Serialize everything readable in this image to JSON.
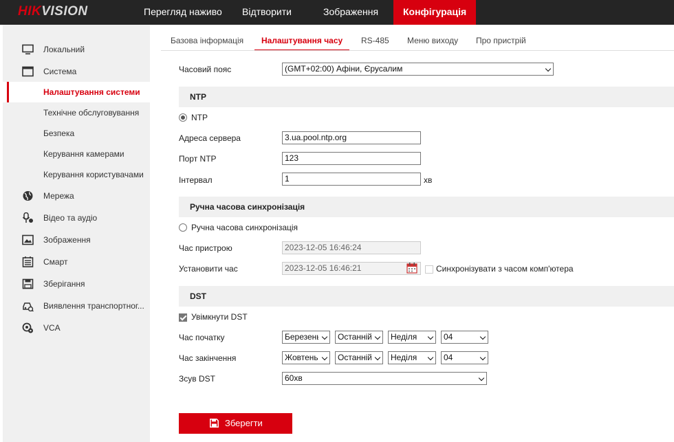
{
  "brand": {
    "part1": "HIK",
    "part2": "VISION"
  },
  "nav": [
    {
      "label": "Перегляд наживо"
    },
    {
      "label": "Відтворити"
    },
    {
      "label": "Зображення"
    },
    {
      "label": "Конфігурація"
    }
  ],
  "sidebar": {
    "items": [
      {
        "label": "Локальний",
        "icon": "monitor-icon"
      },
      {
        "label": "Система",
        "icon": "system-icon"
      },
      {
        "label": "Налаштування системи"
      },
      {
        "label": "Технічне обслуговування"
      },
      {
        "label": "Безпека"
      },
      {
        "label": "Керування камерами"
      },
      {
        "label": "Керування користувачами"
      },
      {
        "label": "Мережа",
        "icon": "globe-icon"
      },
      {
        "label": "Відео та аудіо",
        "icon": "microphone-icon"
      },
      {
        "label": "Зображення",
        "icon": "image-icon"
      },
      {
        "label": "Смарт",
        "icon": "calendar-icon"
      },
      {
        "label": "Зберігання",
        "icon": "storage-icon"
      },
      {
        "label": "Виявлення транспортног...",
        "icon": "vehicle-detection-icon"
      },
      {
        "label": "VCA",
        "icon": "vca-icon"
      }
    ]
  },
  "tabs": [
    {
      "label": "Базова інформація"
    },
    {
      "label": "Налаштування часу"
    },
    {
      "label": "RS-485"
    },
    {
      "label": "Меню виходу"
    },
    {
      "label": "Про пристрій"
    }
  ],
  "form": {
    "timezone_label": "Часовий пояс",
    "timezone_value": "(GMT+02:00) Афіни, Єрусалим",
    "ntp_section": "NTP",
    "ntp_radio_label": "NTP",
    "server_label": "Адреса сервера",
    "server_value": "3.ua.pool.ntp.org",
    "port_label": "Порт NTP",
    "port_value": "123",
    "interval_label": "Інтервал",
    "interval_value": "1",
    "interval_unit": "хв",
    "manual_section": "Ручна часова синхронізація",
    "manual_radio_label": "Ручна часова синхронізація",
    "device_time_label": "Час пристрою",
    "device_time_value": "2023-12-05 16:46:24",
    "set_time_label": "Установити час",
    "set_time_value": "2023-12-05 16:46:21",
    "sync_pc_label": "Синхронізувати з часом комп'ютера",
    "dst_section": "DST",
    "dst_enable_label": "Увімкнути DST",
    "start_label": "Час початку",
    "start": {
      "month": "Березень",
      "week": "Останній",
      "day": "Неділя",
      "hour": "04"
    },
    "end_label": "Час закінчення",
    "end": {
      "month": "Жовтень",
      "week": "Останній",
      "day": "Неділя",
      "hour": "04"
    },
    "offset_label": "Зсув DST",
    "offset_value": "60хв",
    "save_label": "Зберегти"
  },
  "colors": {
    "accent": "#d7000f",
    "topbar": "#252525",
    "sidebar": "#f0f0f0"
  }
}
